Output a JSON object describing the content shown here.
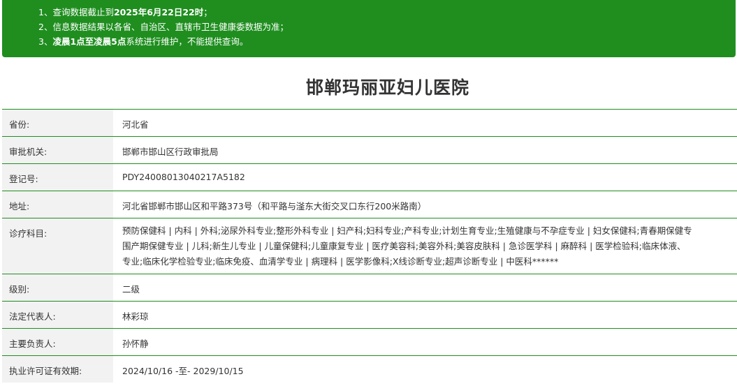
{
  "notice": {
    "line1_prefix": "1、查询数据截止到",
    "line1_bold": "2025年6月22日22时",
    "line1_suffix": "；",
    "line2": "2、信息数据结果以各省、自治区、直辖市卫生健康委数据为准；",
    "line3_prefix": "3、",
    "line3_bold": "凌晨1点至凌晨5点",
    "line3_suffix": "系统进行维护，不能提供查询。"
  },
  "title": "邯郸玛丽亚妇儿医院",
  "rows": {
    "province": {
      "label": "省份:",
      "value": "河北省"
    },
    "authority": {
      "label": "审批机关:",
      "value": "邯郸市邯山区行政审批局"
    },
    "reg_no": {
      "label": "登记号:",
      "value": "PDY24008013040217A5182"
    },
    "address": {
      "label": "地址:",
      "value": "河北省邯郸市邯山区和平路373号（和平路与滏东大街交叉口东行200米路南）"
    },
    "departments": {
      "label": "诊疗科目:",
      "line1": "预防保健科 | 内科 | 外科;泌尿外科专业;整形外科专业 | 妇产科;妇科专业;产科专业;计划生育专业;生殖健康与不孕症专业 | 妇女保健科;青春期保健专",
      "line2": "围产期保健专业 | 儿科;新生儿专业 | 儿童保健科;儿童康复专业 | 医疗美容科;美容外科;美容皮肤科 | 急诊医学科 | 麻醉科 | 医学检验科;临床体液、",
      "line3": "专业;临床化学检验专业;临床免疫、血清学专业 | 病理科 | 医学影像科;X线诊断专业;超声诊断专业 | 中医科******"
    },
    "level": {
      "label": "级别:",
      "value": "二级"
    },
    "legal_rep": {
      "label": "法定代表人:",
      "value": "林彩琼"
    },
    "principal": {
      "label": "主要负责人:",
      "value": "孙怀静"
    },
    "license": {
      "label": "执业许可证有效期:",
      "value": "2024/10/16 -至- 2029/10/15"
    }
  }
}
